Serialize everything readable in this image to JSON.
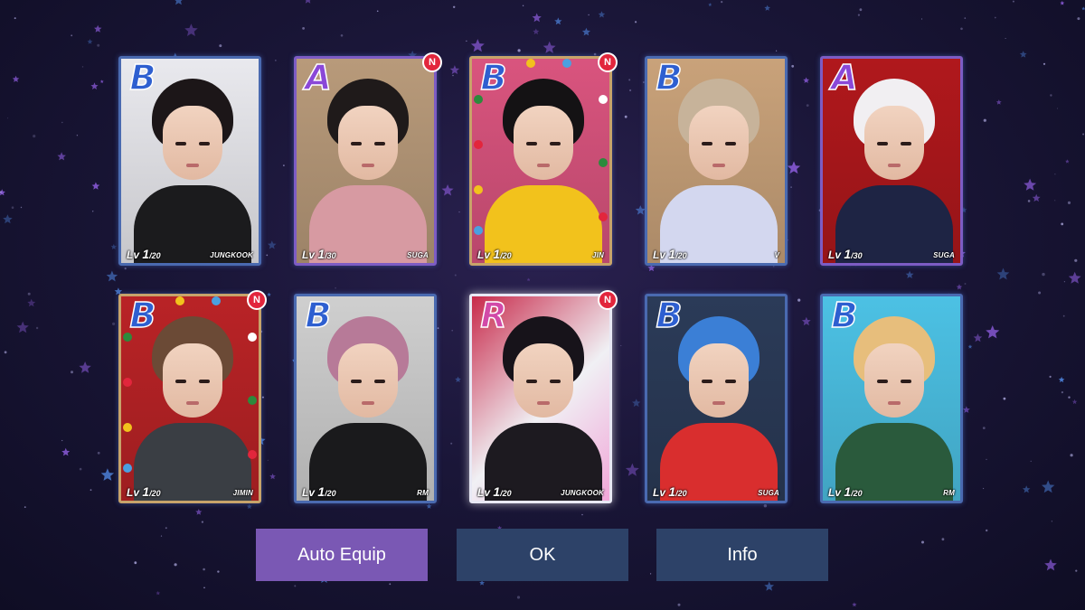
{
  "cards": [
    {
      "grade": "B",
      "level": "1",
      "max": "/20",
      "member": "JUNGKOOK",
      "is_new": false,
      "theme": "normal",
      "colors": {
        "bg": "#e9e9ee",
        "hair": "#1c1618",
        "torso": "#1b1b1d"
      }
    },
    {
      "grade": "A",
      "level": "1",
      "max": "/30",
      "member": "SUGA",
      "is_new": true,
      "theme": "normal",
      "colors": {
        "bg": "#b89a7a",
        "hair": "#1f1a1a",
        "torso": "#d79aa2"
      }
    },
    {
      "grade": "B",
      "level": "1",
      "max": "/20",
      "member": "JIN",
      "is_new": true,
      "theme": "xmas",
      "colors": {
        "bg": "#d9547e",
        "hair": "#141214",
        "torso": "#f2c21c"
      }
    },
    {
      "grade": "B",
      "level": "1",
      "max": "/20",
      "member": "V",
      "is_new": false,
      "theme": "normal",
      "colors": {
        "bg": "#c9a27a",
        "hair": "#c7b39a",
        "torso": "#d3d7ef"
      }
    },
    {
      "grade": "A",
      "level": "1",
      "max": "/30",
      "member": "SUGA",
      "is_new": false,
      "theme": "normal",
      "colors": {
        "bg": "#b0181c",
        "hair": "#f1eff2",
        "torso": "#1e2444"
      }
    },
    {
      "grade": "B",
      "level": "1",
      "max": "/20",
      "member": "JIMIN",
      "is_new": true,
      "theme": "xmas",
      "colors": {
        "bg": "#b92326",
        "hair": "#6b4a36",
        "torso": "#3a3e44"
      }
    },
    {
      "grade": "B",
      "level": "1",
      "max": "/20",
      "member": "RM",
      "is_new": false,
      "theme": "normal",
      "colors": {
        "bg": "#cfcfcf",
        "hair": "#b77a98",
        "torso": "#1a1a1c"
      }
    },
    {
      "grade": "R",
      "level": "1",
      "max": "/20",
      "member": "JUNGKOOK",
      "is_new": true,
      "theme": "rare",
      "colors": {
        "bg": "#c8294a",
        "hair": "#17131a",
        "torso": "#1d1a20"
      }
    },
    {
      "grade": "B",
      "level": "1",
      "max": "/20",
      "member": "SUGA",
      "is_new": false,
      "theme": "normal",
      "colors": {
        "bg": "#2b3b58",
        "hair": "#3b7fd6",
        "torso": "#d92e2e"
      }
    },
    {
      "grade": "B",
      "level": "1",
      "max": "/20",
      "member": "RM",
      "is_new": false,
      "theme": "normal",
      "colors": {
        "bg": "#4cc1e4",
        "hair": "#e7be7c",
        "torso": "#2a5a3c"
      }
    }
  ],
  "buttons": {
    "auto_equip": "Auto Equip",
    "ok": "OK",
    "info": "Info"
  },
  "new_badge": "N",
  "lv_prefix": "Lv",
  "colors": {
    "background": "#1a1638",
    "star_purple": "#8a5ad8",
    "star_blue": "#4f86e0",
    "button_primary": "#7a58b4",
    "button_secondary": "#2d4268"
  },
  "icons": {
    "star": "star-icon",
    "new": "new-badge-icon",
    "grade": "grade-letter-icon"
  }
}
